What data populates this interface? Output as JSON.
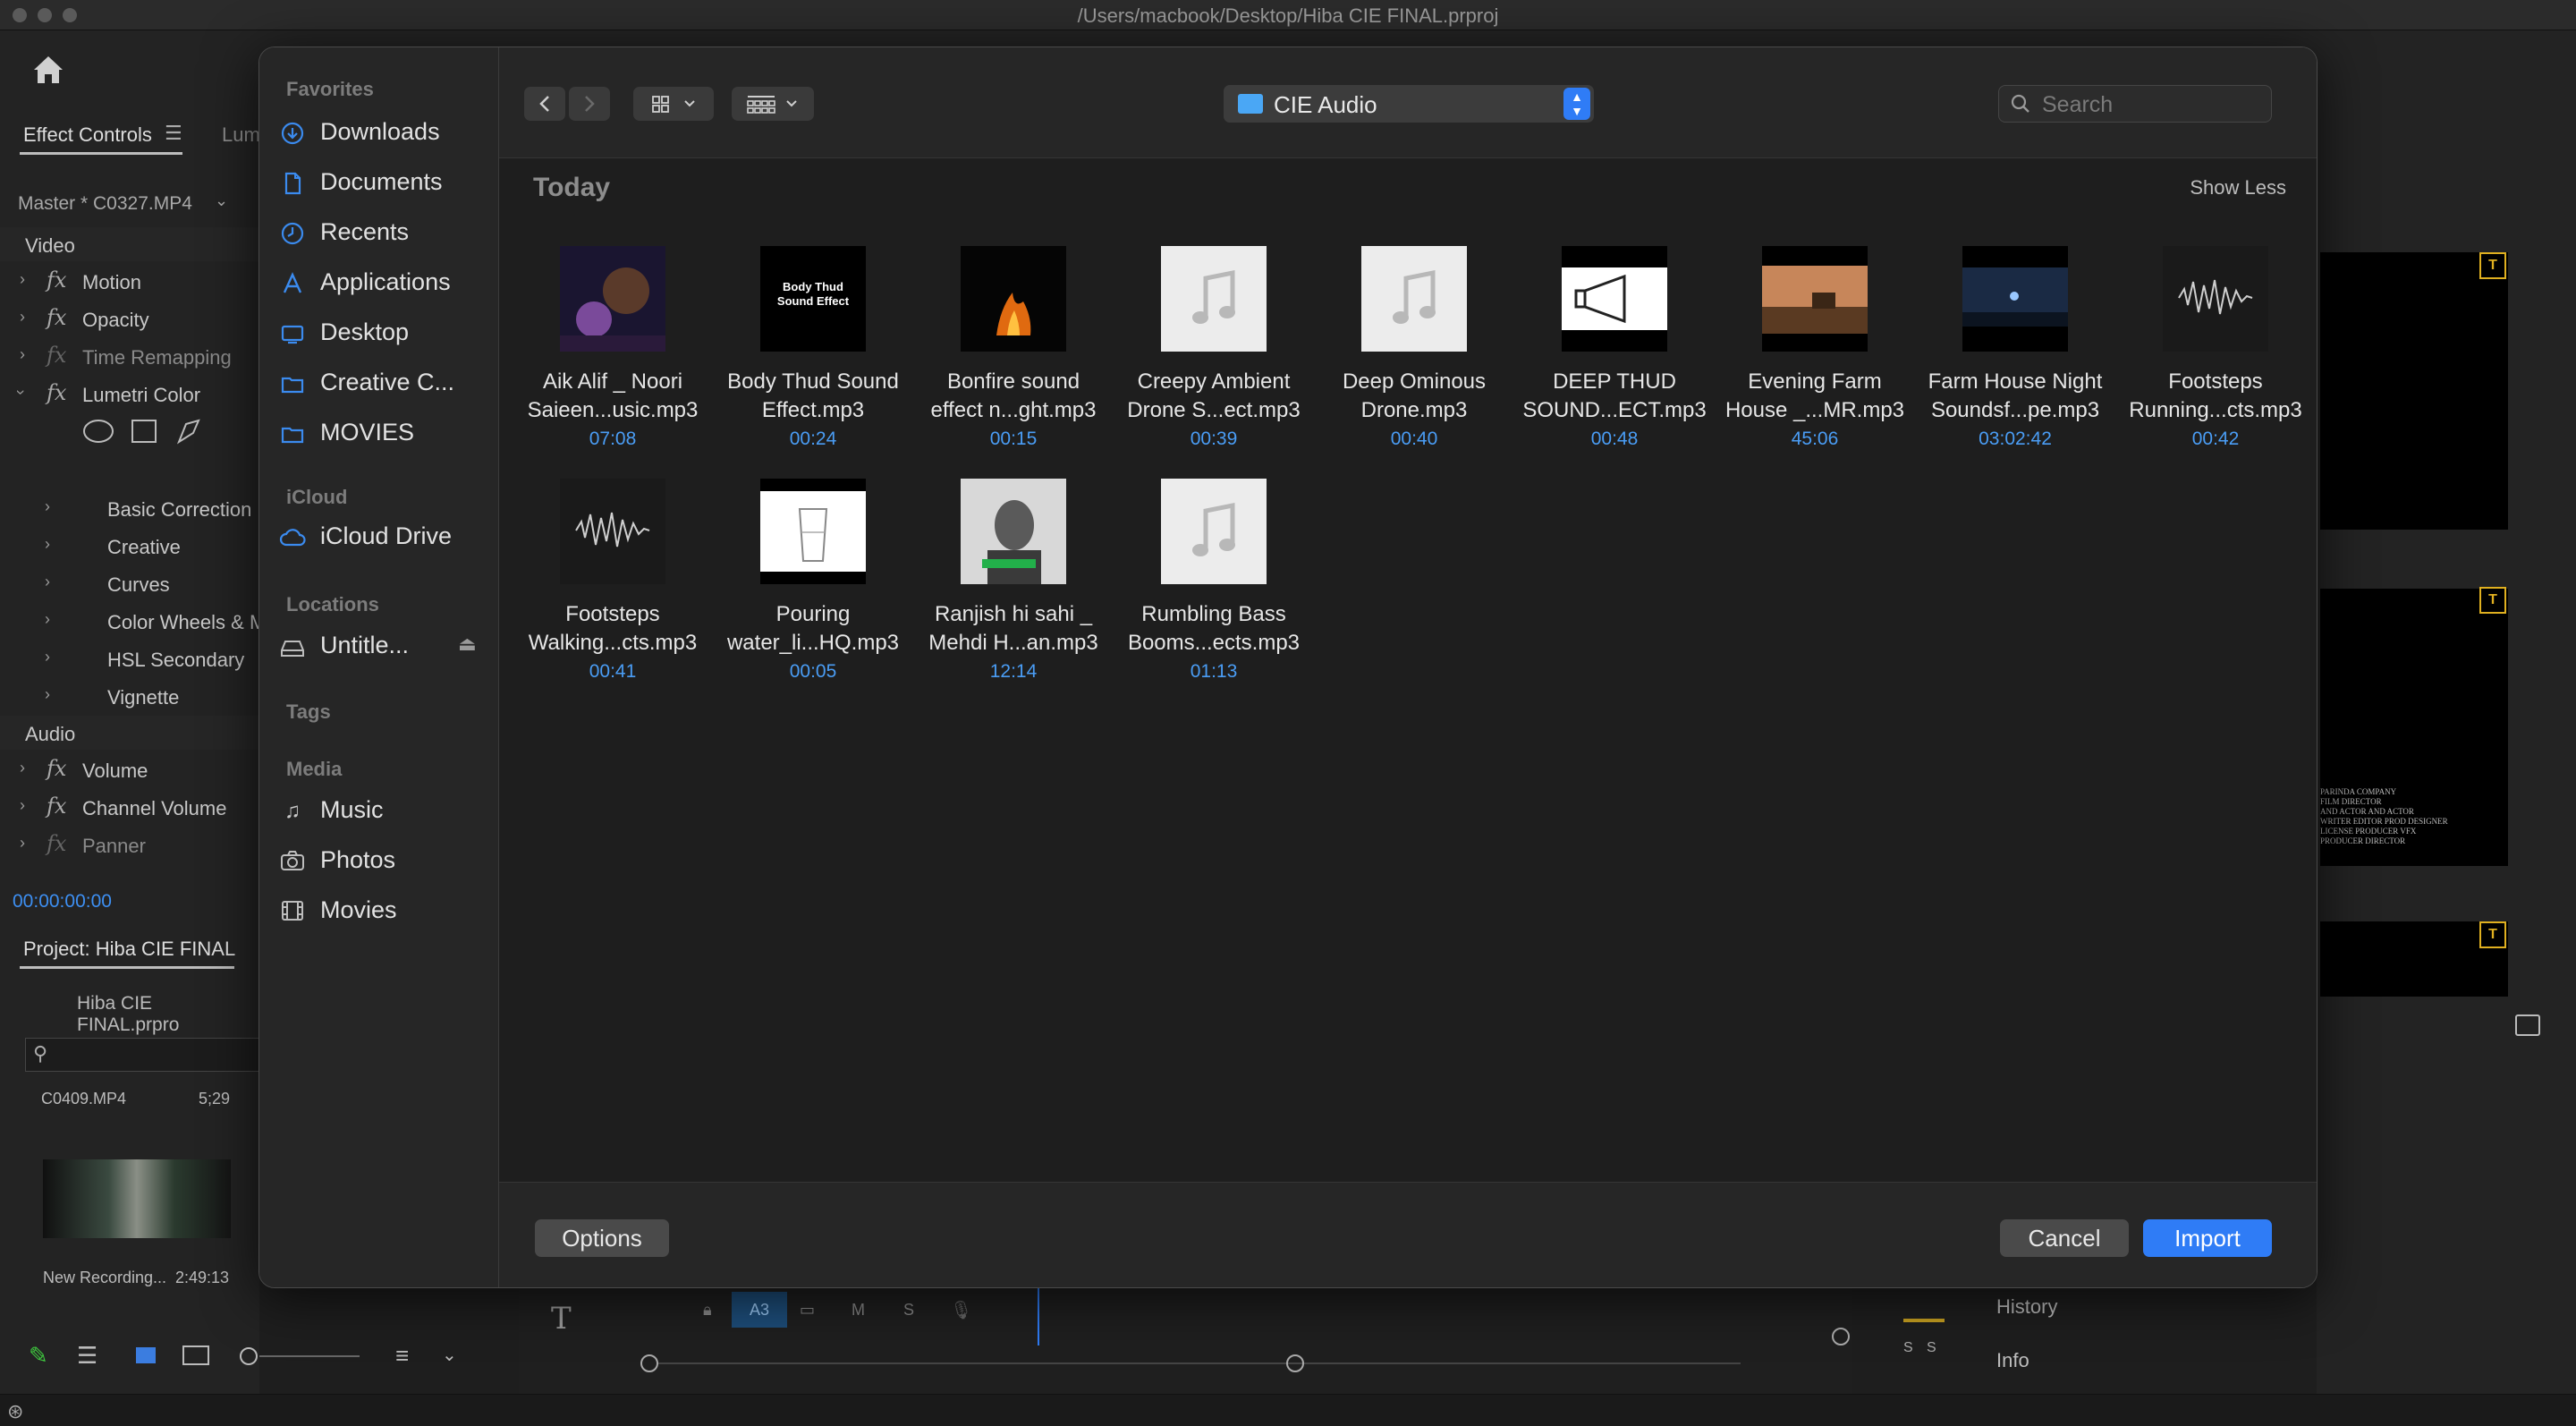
{
  "window": {
    "title": "/Users/macbook/Desktop/Hiba CIE FINAL.prproj"
  },
  "background_app": {
    "effect_controls_tab": "Effect Controls",
    "lumetri_tab_partial": "Lum",
    "master_clip": "Master * C0327.MP4",
    "video_header": "Video",
    "video_effects": [
      "Motion",
      "Opacity",
      "Time Remapping",
      "Lumetri Color"
    ],
    "lumetri_sections": [
      "Basic Correction",
      "Creative",
      "Curves",
      "Color Wheels & M",
      "HSL Secondary",
      "Vignette"
    ],
    "audio_header": "Audio",
    "audio_effects": [
      "Volume",
      "Channel Volume",
      "Panner"
    ],
    "timecode": "00:00:00:00",
    "project_tab": "Project: Hiba CIE FINAL",
    "project_file": "Hiba CIE FINAL.prpro",
    "clip_name": "C0409.MP4",
    "clip_duration": "5;29",
    "recording_name": "New Recording...",
    "recording_duration": "2:49:13",
    "track_label": "A3",
    "track_m": "M",
    "track_s": "S",
    "history_label": "History",
    "info_label": "Info",
    "ss_left": "S",
    "ss_right": "S",
    "credits_lines": [
      "PARINDA COMPANY",
      "FILM DIRECTOR",
      "AND ACTOR AND ACTOR",
      "WRITER  EDITOR  PROD DESIGNER",
      "LICENSE PRODUCER  VFX",
      "PRODUCER  DIRECTOR"
    ]
  },
  "dialog": {
    "sidebar": {
      "favorites_header": "Favorites",
      "favorites": [
        {
          "label": "Downloads",
          "icon": "download-icon"
        },
        {
          "label": "Documents",
          "icon": "document-icon"
        },
        {
          "label": "Recents",
          "icon": "clock-icon"
        },
        {
          "label": "Applications",
          "icon": "applications-icon"
        },
        {
          "label": "Desktop",
          "icon": "desktop-icon"
        },
        {
          "label": "Creative C...",
          "icon": "folder-icon"
        },
        {
          "label": "MOVIES",
          "icon": "folder-icon"
        }
      ],
      "icloud_header": "iCloud",
      "icloud_items": [
        {
          "label": "iCloud Drive",
          "icon": "cloud-icon"
        }
      ],
      "locations_header": "Locations",
      "locations": [
        {
          "label": "Untitle...",
          "icon": "drive-icon"
        }
      ],
      "tags_header": "Tags",
      "media_header": "Media",
      "media": [
        {
          "label": "Music",
          "icon": "music-note-icon"
        },
        {
          "label": "Photos",
          "icon": "camera-icon"
        },
        {
          "label": "Movies",
          "icon": "film-icon"
        }
      ]
    },
    "toolbar": {
      "location": "CIE Audio",
      "search_placeholder": "Search"
    },
    "section": {
      "title": "Today",
      "toggle": "Show Less"
    },
    "files": [
      {
        "name": "Aik Alif _ Noori\nSaieen...usic.mp3",
        "duration": "07:08",
        "thumb": "image"
      },
      {
        "name": "Body Thud Sound\nEffect.mp3",
        "duration": "00:24",
        "thumb": "text",
        "thumb_text": "Body Thud\nSound Effect"
      },
      {
        "name": "Bonfire sound\neffect  n...ght.mp3",
        "duration": "00:15",
        "thumb": "fire"
      },
      {
        "name": "Creepy Ambient\nDrone S...ect.mp3",
        "duration": "00:39",
        "thumb": "music"
      },
      {
        "name": "Deep Ominous\nDrone.mp3",
        "duration": "00:40",
        "thumb": "music"
      },
      {
        "name": "DEEP THUD\nSOUND...ECT.mp3",
        "duration": "00:48",
        "thumb": "megaphone"
      },
      {
        "name": "Evening Farm\nHouse _...MR.mp3",
        "duration": "45:06",
        "thumb": "farm"
      },
      {
        "name": "Farm House Night\nSoundsf...pe.mp3",
        "duration": "03:02:42",
        "thumb": "night"
      },
      {
        "name": "Footsteps\nRunning...cts.mp3",
        "duration": "00:42",
        "thumb": "wave"
      },
      {
        "name": "Footsteps\nWalking...cts.mp3",
        "duration": "00:41",
        "thumb": "wave"
      },
      {
        "name": "Pouring\nwater_li...HQ.mp3",
        "duration": "00:05",
        "thumb": "glass"
      },
      {
        "name": "Ranjish hi sahi _\nMehdi H...an.mp3",
        "duration": "12:14",
        "thumb": "portrait"
      },
      {
        "name": "Rumbling Bass\nBooms...ects.mp3",
        "duration": "01:13",
        "thumb": "music"
      }
    ],
    "buttons": {
      "options": "Options",
      "cancel": "Cancel",
      "import": "Import"
    }
  }
}
